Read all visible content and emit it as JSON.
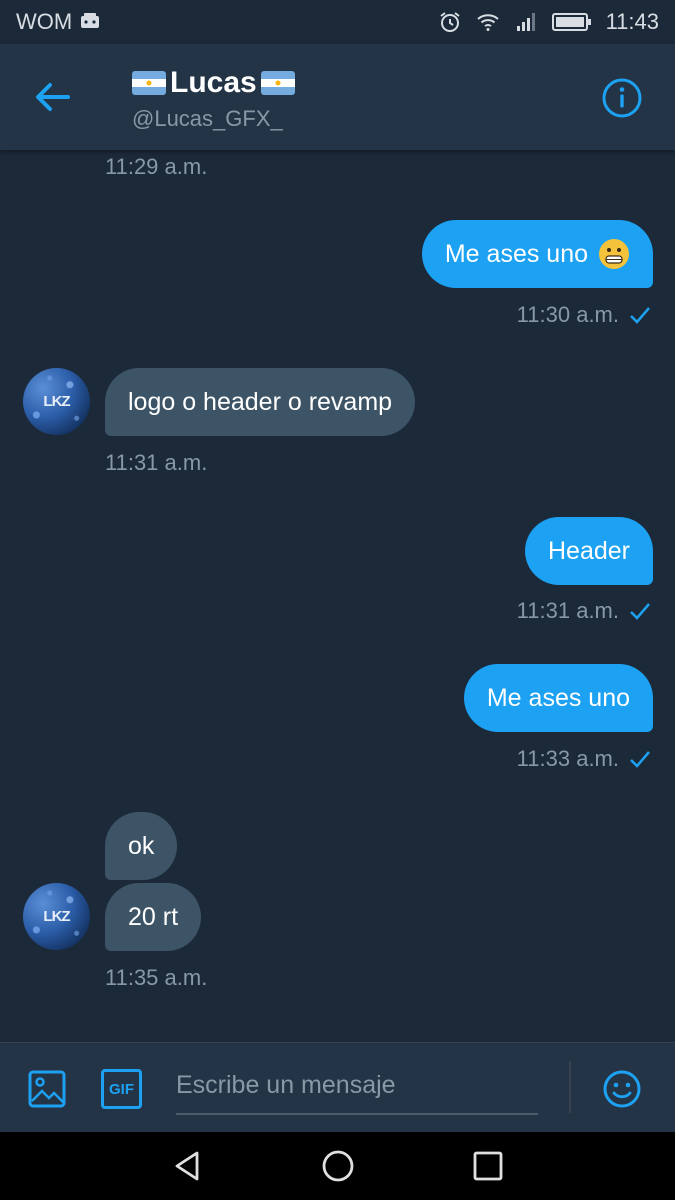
{
  "status_bar": {
    "carrier": "WOM",
    "time": "11:43",
    "icons": [
      "sim-icon",
      "alarm-icon",
      "wifi-icon",
      "signal-icon",
      "battery-icon"
    ]
  },
  "header": {
    "back_icon": "back-arrow-icon",
    "name": "Lucas",
    "name_decoration": "argentina-flag-icon",
    "handle": "@Lucas_GFX_",
    "info_icon": "info-icon"
  },
  "messages": [
    {
      "id": "t0",
      "type": "timestamp",
      "side": "in",
      "time": "11:29 a.m."
    },
    {
      "id": "m1",
      "type": "message",
      "side": "out",
      "text": "Me ases uno",
      "emoji": "grimacing-face-icon",
      "time": "11:30 a.m.",
      "read": true
    },
    {
      "id": "m2",
      "type": "message",
      "side": "in",
      "text": "logo o header o revamp",
      "time": "11:31 a.m."
    },
    {
      "id": "m3",
      "type": "message",
      "side": "out",
      "text": "Header",
      "time": "11:31 a.m.",
      "read": true
    },
    {
      "id": "m4",
      "type": "message",
      "side": "out",
      "text": "Me ases uno",
      "time": "11:33 a.m.",
      "read": true
    },
    {
      "id": "m5",
      "type": "message",
      "side": "in",
      "text": "ok"
    },
    {
      "id": "m6",
      "type": "message",
      "side": "in",
      "text": "20 rt",
      "time": "11:35 a.m."
    }
  ],
  "avatar": {
    "text": "LKZ"
  },
  "composer": {
    "image_icon": "image-icon",
    "gif_label": "GIF",
    "placeholder": "Escribe un mensaje",
    "value": "",
    "emoji_icon": "emoji-icon"
  },
  "nav": {
    "back": "nav-back-icon",
    "home": "nav-home-icon",
    "recents": "nav-recents-icon"
  },
  "colors": {
    "background": "#1c2938",
    "header": "#243447",
    "accent": "#1da1f2",
    "incoming_bubble": "#3d5466",
    "muted_text": "#8899a6"
  }
}
